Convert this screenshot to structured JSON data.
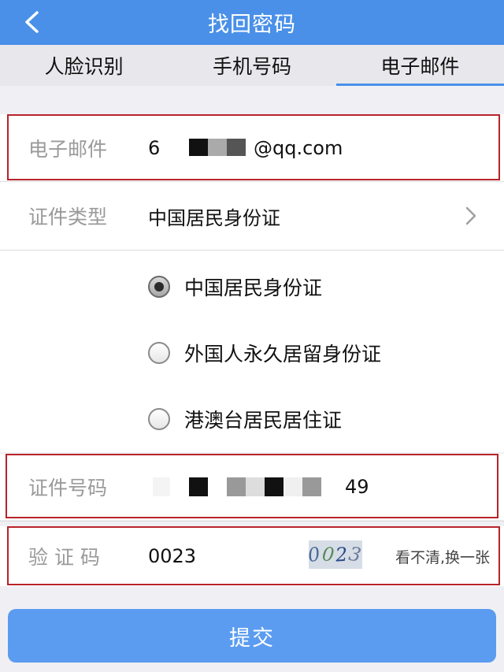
{
  "header": {
    "title": "找回密码",
    "back_icon": "chevron-left-icon"
  },
  "tabs": [
    {
      "label": "人脸识别",
      "active": false
    },
    {
      "label": "手机号码",
      "active": false
    },
    {
      "label": "电子邮件",
      "active": true
    }
  ],
  "email": {
    "label": "电子邮件",
    "value_prefix": "6",
    "value_suffix": "@qq.com"
  },
  "id_type": {
    "label": "证件类型",
    "value": "中国居民身份证"
  },
  "id_options": [
    {
      "label": "中国居民身份证",
      "checked": true
    },
    {
      "label": "外国人永久居留身份证",
      "checked": false
    },
    {
      "label": "港澳台居民居住证",
      "checked": false
    }
  ],
  "id_number": {
    "label": "证件号码",
    "value_suffix": "49"
  },
  "captcha": {
    "label": "验 证 码",
    "value": "0023",
    "image_text": [
      "0",
      "0",
      "2",
      "3"
    ],
    "refresh_label": "看不清,换一张"
  },
  "submit": {
    "label": "提交"
  },
  "colors": {
    "header": "#4a90e8",
    "accent": "#4a90e8",
    "submit": "#5b9cf0",
    "highlight_box": "#b8232a"
  }
}
